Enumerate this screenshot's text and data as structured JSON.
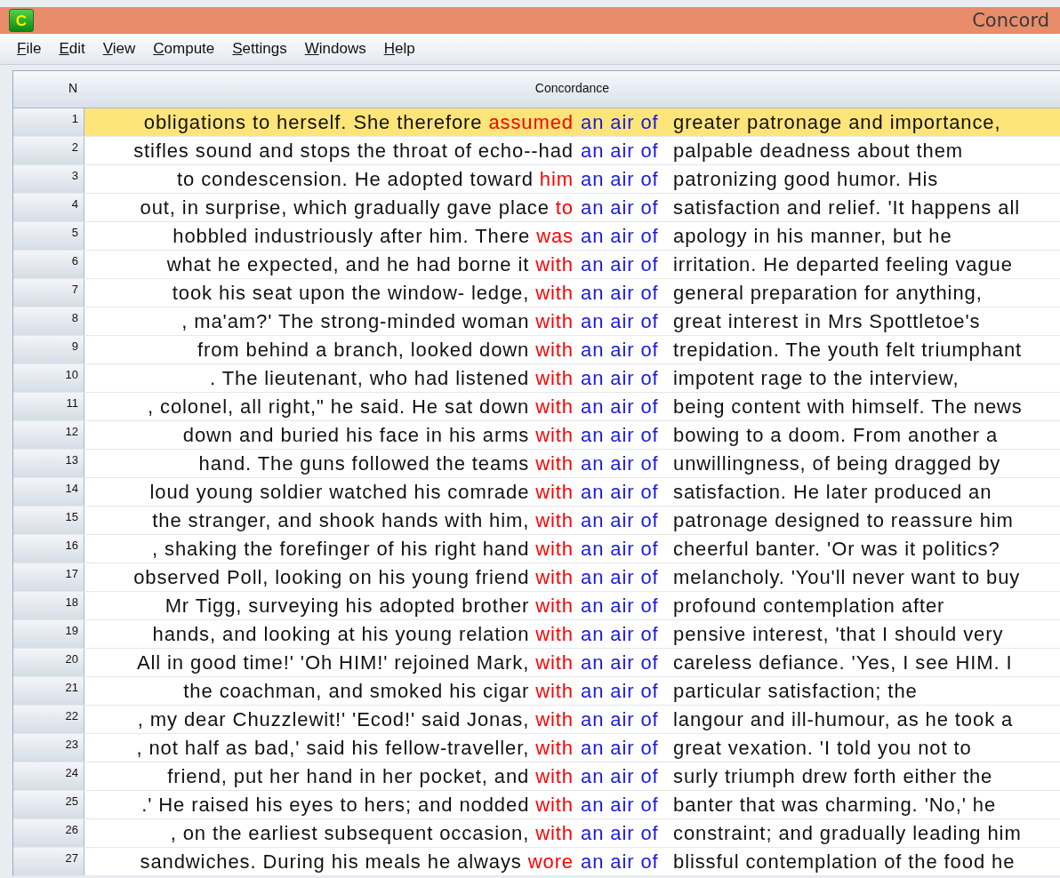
{
  "window": {
    "title": "Concord",
    "icon_letter": "C"
  },
  "menu": [
    {
      "label": "File"
    },
    {
      "label": "Edit"
    },
    {
      "label": "View"
    },
    {
      "label": "Compute"
    },
    {
      "label": "Settings"
    },
    {
      "label": "Windows"
    },
    {
      "label": "Help"
    }
  ],
  "table": {
    "columns": [
      "N",
      "Concordance"
    ],
    "rows": [
      {
        "n": "1",
        "selected": true,
        "left": "obligations to herself. She therefore",
        "collocate": "assumed",
        "node": "an air of",
        "right": "greater patronage and importance,"
      },
      {
        "n": "2",
        "selected": false,
        "left": "stifles sound and stops the throat of echo--had",
        "node": "an air of",
        "right": "palpable deadness about them"
      },
      {
        "n": "3",
        "selected": false,
        "left": "to condescension. He adopted toward",
        "collocate": "him",
        "node": "an air of",
        "right": "patronizing good humor. His"
      },
      {
        "n": "4",
        "selected": false,
        "left": "out, in surprise, which gradually gave place",
        "collocate": "to",
        "node": "an air of",
        "right": "satisfaction and relief. 'It happens all"
      },
      {
        "n": "5",
        "selected": false,
        "left": "hobbled industriously after him. There",
        "collocate": "was",
        "node": "an air of",
        "right": "apology in his manner, but he"
      },
      {
        "n": "6",
        "selected": false,
        "left": "what he expected, and he had borne it",
        "collocate": "with",
        "node": "an air of",
        "right": "irritation. He departed feeling vague"
      },
      {
        "n": "7",
        "selected": false,
        "left": "took his seat upon the window- ledge,",
        "collocate": "with",
        "node": "an air of",
        "right": "general preparation for anything,"
      },
      {
        "n": "8",
        "selected": false,
        "left": ", ma'am?' The strong-minded woman",
        "collocate": "with",
        "node": "an air of",
        "right": "great interest in Mrs Spottletoe's"
      },
      {
        "n": "9",
        "selected": false,
        "left": "from behind a branch, looked down",
        "collocate": "with",
        "node": "an air of",
        "right": "trepidation. The youth felt triumphant"
      },
      {
        "n": "10",
        "selected": false,
        "left": ". The lieutenant, who had listened",
        "collocate": "with",
        "node": "an air of",
        "right": "impotent rage to the interview,"
      },
      {
        "n": "11",
        "selected": false,
        "left": ", colonel, all right,\" he said. He sat down",
        "collocate": "with",
        "node": "an air of",
        "right": "being content with himself. The news"
      },
      {
        "n": "12",
        "selected": false,
        "left": "down and buried his face in his arms",
        "collocate": "with",
        "node": "an air of",
        "right": "bowing to a doom. From another a"
      },
      {
        "n": "13",
        "selected": false,
        "left": "hand. The guns followed the teams",
        "collocate": "with",
        "node": "an air of",
        "right": "unwillingness, of being dragged by"
      },
      {
        "n": "14",
        "selected": false,
        "left": "loud young soldier watched his comrade",
        "collocate": "with",
        "node": "an air of",
        "right": "satisfaction. He later produced an"
      },
      {
        "n": "15",
        "selected": false,
        "left": "the stranger, and shook hands with him,",
        "collocate": "with",
        "node": "an air of",
        "right": "patronage designed to reassure him"
      },
      {
        "n": "16",
        "selected": false,
        "left": ", shaking the forefinger of his right hand",
        "collocate": "with",
        "node": "an air of",
        "right": "cheerful banter. 'Or was it politics?"
      },
      {
        "n": "17",
        "selected": false,
        "left": "observed Poll, looking on his young friend",
        "collocate": "with",
        "node": "an air of",
        "right": "melancholy. 'You'll never want to buy"
      },
      {
        "n": "18",
        "selected": false,
        "left": "Mr Tigg, surveying his adopted brother",
        "collocate": "with",
        "node": "an air of",
        "right": "profound contemplation after"
      },
      {
        "n": "19",
        "selected": false,
        "left": "hands, and looking at his young relation",
        "collocate": "with",
        "node": "an air of",
        "right": "pensive interest, 'that I should very"
      },
      {
        "n": "20",
        "selected": false,
        "left": "All in good time!' 'Oh HIM!' rejoined Mark,",
        "collocate": "with",
        "node": "an air of",
        "right": "careless defiance. 'Yes, I see HIM. I"
      },
      {
        "n": "21",
        "selected": false,
        "left": "the coachman, and smoked his cigar",
        "collocate": "with",
        "node": "an air of",
        "right": "particular satisfaction; the"
      },
      {
        "n": "22",
        "selected": false,
        "left": ", my dear Chuzzlewit!' 'Ecod!' said Jonas,",
        "collocate": "with",
        "node": "an air of",
        "right": "langour and ill-humour, as he took a"
      },
      {
        "n": "23",
        "selected": false,
        "left": ", not half as bad,' said his fellow-traveller,",
        "collocate": "with",
        "node": "an air of",
        "right": "great vexation. 'I told you not to"
      },
      {
        "n": "24",
        "selected": false,
        "left": "friend, put her hand in her pocket, and",
        "collocate": "with",
        "node": "an air of",
        "right": "surly triumph drew forth either the"
      },
      {
        "n": "25",
        "selected": false,
        "left": ".' He raised his eyes to hers; and nodded",
        "collocate": "with",
        "node": "an air of",
        "right": "banter that was charming. 'No,' he"
      },
      {
        "n": "26",
        "selected": false,
        "left": ", on the earliest subsequent occasion,",
        "collocate": "with",
        "node": "an air of",
        "right": "constraint; and gradually leading him"
      },
      {
        "n": "27",
        "selected": false,
        "left": "sandwiches. During his meals he always",
        "collocate": "wore",
        "node": "an air of",
        "right": "blissful contemplation of the food he"
      }
    ]
  }
}
